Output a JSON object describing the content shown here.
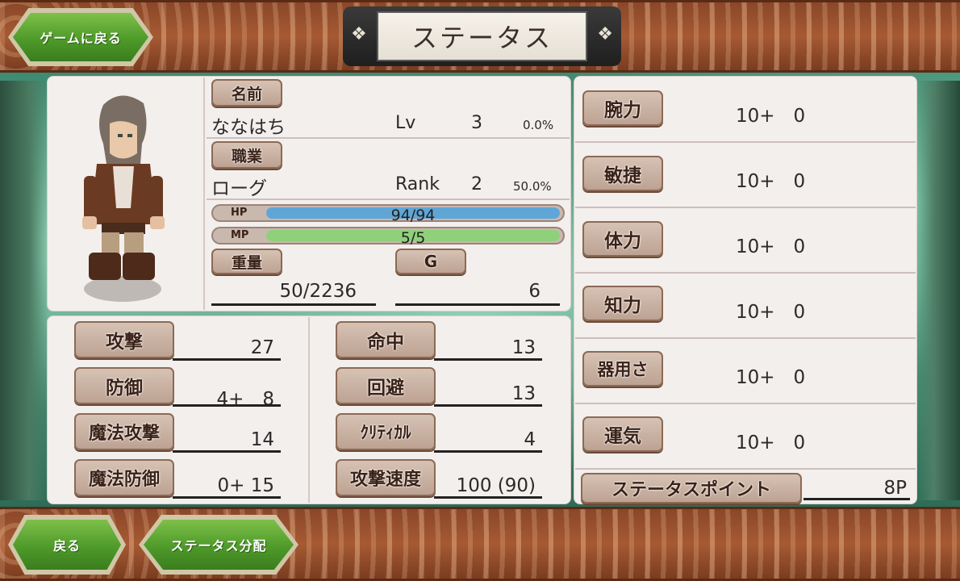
{
  "header": {
    "back_to_game": "ゲームに戻る",
    "title": "ステータス"
  },
  "character": {
    "name_label": "名前",
    "name": "ななはち",
    "lv_label": "Lv",
    "lv": "3",
    "lv_pct": "0.0%",
    "job_label": "職業",
    "job": "ローグ",
    "rank_label": "Rank",
    "rank": "2",
    "rank_pct": "50.0%",
    "hp_label": "HP",
    "hp": "94/94",
    "hp_fraction": 1.0,
    "mp_label": "MP",
    "mp": "5/5",
    "mp_fraction": 1.0,
    "weight_label": "重量",
    "weight": "50/2236",
    "gold_label": "G",
    "gold": "6"
  },
  "combat": {
    "attack_label": "攻撃",
    "attack": "27",
    "defense_label": "防御",
    "defense": "4+　8",
    "mattack_label": "魔法攻撃",
    "mattack": "14",
    "mdefense_label": "魔法防御",
    "mdefense": "0+ 15",
    "hit_label": "命中",
    "hit": "13",
    "evade_label": "回避",
    "evade": "13",
    "crit_label": "ｸﾘﾃｨｶﾙ",
    "crit": "4",
    "speed_label": "攻撃速度",
    "speed": "100 (90)"
  },
  "stats": [
    {
      "label": "腕力",
      "value": "10+　0"
    },
    {
      "label": "敏捷",
      "value": "10+　0"
    },
    {
      "label": "体力",
      "value": "10+　0"
    },
    {
      "label": "知力",
      "value": "10+　0"
    },
    {
      "label": "器用さ",
      "value": "10+　0"
    },
    {
      "label": "運気",
      "value": "10+　0"
    }
  ],
  "status_point_label": "ステータスポイント",
  "status_point": "8P",
  "footer": {
    "back": "戻る",
    "allocate": "ステータス分配"
  },
  "colors": {
    "hp_fill": "#5fa6d6",
    "mp_fill": "#8fd07a",
    "button_green": "#4e9a2a",
    "bar_brown": "#a65a33"
  }
}
